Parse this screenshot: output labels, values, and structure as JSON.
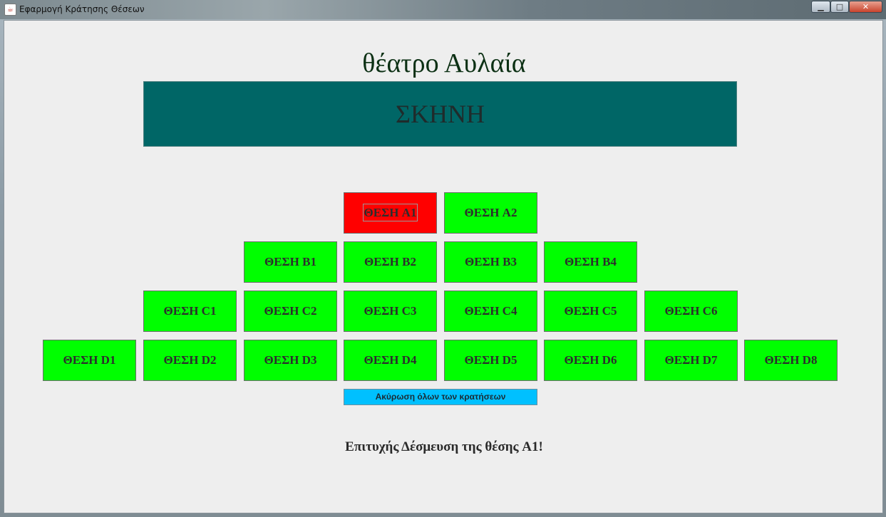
{
  "window": {
    "title": "Εφαρμογή Κράτησης Θέσεων",
    "app_icon": "java-icon",
    "minimize_icon": "minimize-icon",
    "maximize_icon": "maximize-icon",
    "close_icon": "close-icon"
  },
  "theatre": {
    "title": "θέατρο Αυλαία",
    "stage_label": "ΣΚΗΝΗ"
  },
  "seats": {
    "A1": {
      "label": "ΘΕΣΗ A1",
      "status": "reserved"
    },
    "A2": {
      "label": "ΘΕΣΗ A2",
      "status": "free"
    },
    "B1": {
      "label": "ΘΕΣΗ B1",
      "status": "free"
    },
    "B2": {
      "label": "ΘΕΣΗ B2",
      "status": "free"
    },
    "B3": {
      "label": "ΘΕΣΗ B3",
      "status": "free"
    },
    "B4": {
      "label": "ΘΕΣΗ B4",
      "status": "free"
    },
    "C1": {
      "label": "ΘΕΣΗ C1",
      "status": "free"
    },
    "C2": {
      "label": "ΘΕΣΗ C2",
      "status": "free"
    },
    "C3": {
      "label": "ΘΕΣΗ C3",
      "status": "free"
    },
    "C4": {
      "label": "ΘΕΣΗ C4",
      "status": "free"
    },
    "C5": {
      "label": "ΘΕΣΗ C5",
      "status": "free"
    },
    "C6": {
      "label": "ΘΕΣΗ C6",
      "status": "free"
    },
    "D1": {
      "label": "ΘΕΣΗ D1",
      "status": "free"
    },
    "D2": {
      "label": "ΘΕΣΗ D2",
      "status": "free"
    },
    "D3": {
      "label": "ΘΕΣΗ D3",
      "status": "free"
    },
    "D4": {
      "label": "ΘΕΣΗ D4",
      "status": "free"
    },
    "D5": {
      "label": "ΘΕΣΗ D5",
      "status": "free"
    },
    "D6": {
      "label": "ΘΕΣΗ D6",
      "status": "free"
    },
    "D7": {
      "label": "ΘΕΣΗ D7",
      "status": "free"
    },
    "D8": {
      "label": "ΘΕΣΗ D8",
      "status": "free"
    }
  },
  "colors": {
    "free": "#00ff00",
    "reserved": "#ff0000",
    "stage": "#006666",
    "cancel_button": "#00c0ff"
  },
  "cancel_all_label": "Ακύρωση όλων των κρατήσεων",
  "status_message": "Επιτυχής Δέσμευση της θέσης A1!"
}
